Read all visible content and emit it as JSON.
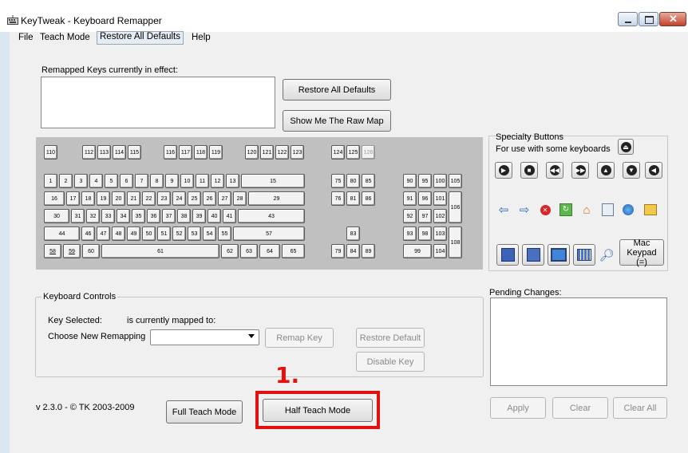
{
  "window": {
    "title": "KeyTweak -  Keyboard Remapper"
  },
  "menu": [
    "File",
    "Teach Mode",
    "Restore All Defaults",
    "Help"
  ],
  "remapped": {
    "label": "Remapped Keys currently in effect:"
  },
  "buttons": {
    "restore_all": "Restore All Defaults",
    "raw_map": "Show Me The Raw Map",
    "remap_key": "Remap Key",
    "restore_default": "Restore Default",
    "disable_key": "Disable Key",
    "full_teach": "Full Teach Mode",
    "half_teach": "Half Teach Mode",
    "apply": "Apply",
    "clear": "Clear",
    "clear_all": "Clear All"
  },
  "controls": {
    "group_title": "Keyboard Controls",
    "key_selected": "Key Selected:",
    "mapped_to": "is currently mapped to:",
    "choose": "Choose New Remapping"
  },
  "specialty": {
    "title": "Specialty Buttons",
    "subtitle": "For use with some keyboards",
    "mac_keypad": "Mac\nKeypad (=)"
  },
  "pending": {
    "label": "Pending Changes:"
  },
  "version": "v 2.3.0 - © TK 2003-2009",
  "annotation": "1.",
  "keyboard": {
    "rows": [
      [
        "110",
        "112",
        "113",
        "114",
        "115",
        "116",
        "117",
        "118",
        "119",
        "120",
        "121",
        "122",
        "123",
        "124",
        "125",
        "126"
      ],
      [
        "1",
        "2",
        "3",
        "4",
        "5",
        "6",
        "7",
        "8",
        "9",
        "10",
        "11",
        "12",
        "13",
        "15",
        "75",
        "80",
        "85",
        "90",
        "95",
        "100",
        "105"
      ],
      [
        "16",
        "17",
        "18",
        "19",
        "20",
        "21",
        "22",
        "23",
        "24",
        "25",
        "26",
        "27",
        "28",
        "29",
        "76",
        "81",
        "86",
        "91",
        "96",
        "101",
        "106"
      ],
      [
        "30",
        "31",
        "32",
        "33",
        "34",
        "35",
        "36",
        "37",
        "38",
        "39",
        "40",
        "41",
        "43",
        "92",
        "97",
        "102"
      ],
      [
        "44",
        "46",
        "47",
        "48",
        "49",
        "50",
        "51",
        "52",
        "53",
        "54",
        "55",
        "57",
        "83",
        "93",
        "98",
        "103",
        "108"
      ],
      [
        "58",
        "59",
        "60",
        "61",
        "62",
        "63",
        "64",
        "65",
        "79",
        "84",
        "89",
        "99",
        "104"
      ]
    ]
  }
}
